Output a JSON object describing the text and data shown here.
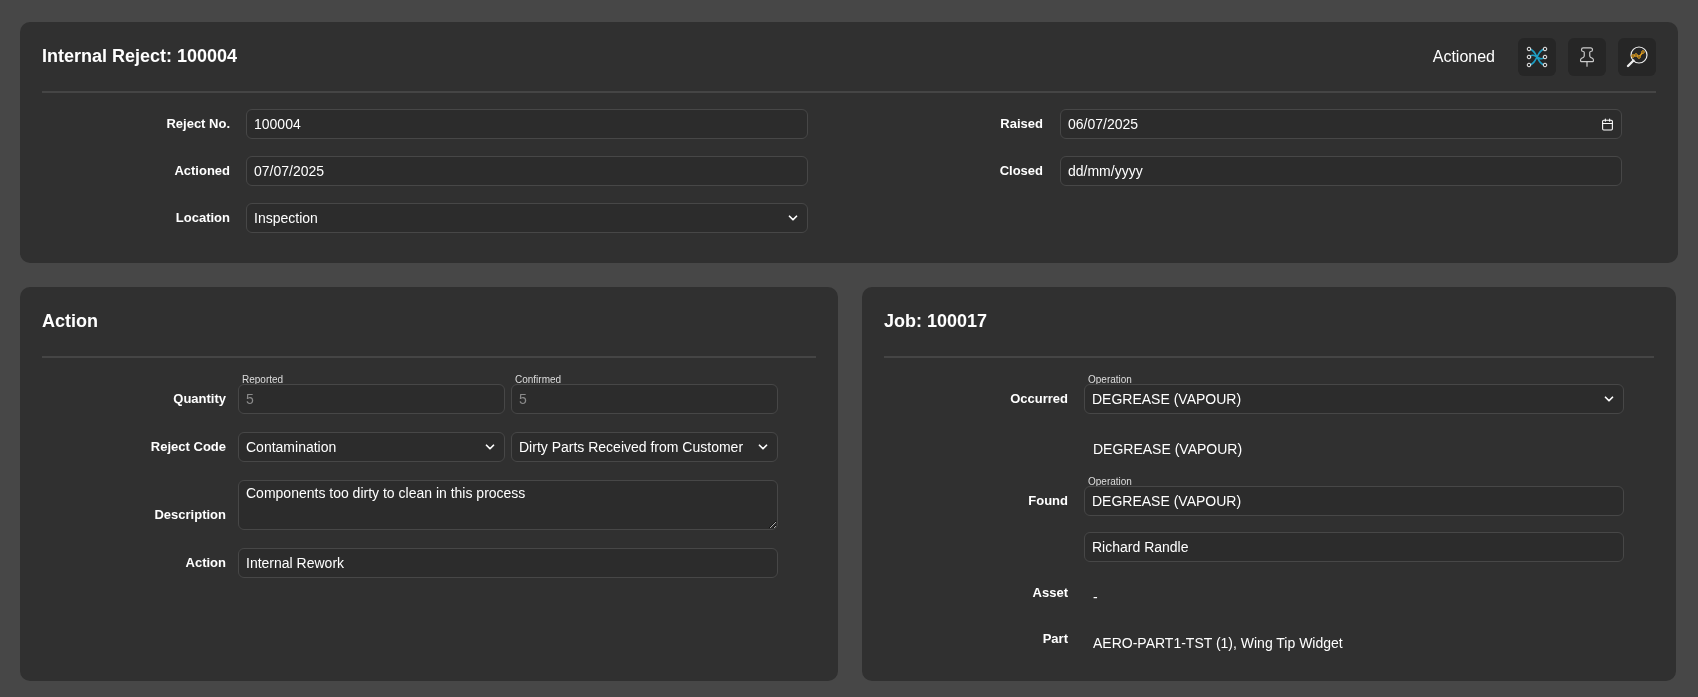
{
  "header": {
    "title": "Internal Reject: 100004",
    "status": "Actioned"
  },
  "header_fields": {
    "left": [
      {
        "label": "Reject No.",
        "controls": [
          {
            "kind": "text",
            "value": "100004"
          }
        ]
      },
      {
        "label": "Actioned",
        "controls": [
          {
            "kind": "text",
            "value": "07/07/2025"
          }
        ]
      },
      {
        "label": "Location",
        "controls": [
          {
            "kind": "select",
            "value": "Inspection"
          }
        ]
      }
    ],
    "right": [
      {
        "label": "Raised",
        "controls": [
          {
            "kind": "date",
            "value": "06/07/2025"
          }
        ]
      },
      {
        "label": "Closed",
        "controls": [
          {
            "kind": "text",
            "placeholder": "dd/mm/yyyy"
          }
        ]
      }
    ]
  },
  "action_card": {
    "title": "Action",
    "rows": [
      {
        "label": "Quantity",
        "controls": [
          {
            "kind": "text",
            "legend": "Reported",
            "value": "5",
            "disabled": true
          },
          {
            "kind": "text",
            "legend": "Confirmed",
            "value": "5",
            "disabled": true
          }
        ]
      },
      {
        "label": "Reject Code",
        "controls": [
          {
            "kind": "select",
            "value": "Contamination"
          },
          {
            "kind": "select",
            "value": "Dirty Parts Received from Customer"
          }
        ]
      },
      {
        "label": "Description",
        "controls": [
          {
            "kind": "textarea",
            "value": "Components too dirty to clean in this process"
          }
        ]
      },
      {
        "label": "Action",
        "controls": [
          {
            "kind": "text",
            "value": "Internal Rework"
          }
        ]
      }
    ]
  },
  "job_card": {
    "title": "Job: 100017",
    "rows": [
      {
        "label": "Occurred",
        "controls": [
          {
            "kind": "select",
            "legend": "Operation",
            "value": "DEGREASE (VAPOUR)"
          }
        ]
      },
      {
        "controls": [
          {
            "kind": "static",
            "value": "DEGREASE (VAPOUR)"
          }
        ]
      },
      {
        "label": "Found",
        "controls": [
          {
            "kind": "text",
            "legend": "Operation",
            "value": "DEGREASE (VAPOUR)"
          }
        ]
      },
      {
        "controls": [
          {
            "kind": "text",
            "value": "Richard Randle"
          }
        ]
      },
      {
        "label": "Asset",
        "controls": [
          {
            "kind": "static",
            "value": "-"
          }
        ]
      },
      {
        "label": "Part",
        "controls": [
          {
            "kind": "static",
            "value": "AERO-PART1-TST (1), Wing Tip Widget"
          }
        ]
      }
    ]
  }
}
